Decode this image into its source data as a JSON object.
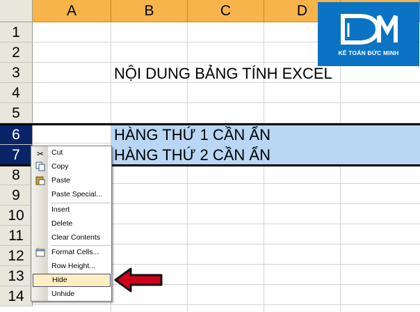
{
  "columns": [
    "A",
    "B",
    "C",
    "D"
  ],
  "rows": [
    "1",
    "2",
    "3",
    "4",
    "5",
    "6",
    "7",
    "8",
    "9",
    "10",
    "11",
    "12",
    "13",
    "14"
  ],
  "selected_rows": [
    "6",
    "7"
  ],
  "cells": {
    "b3": "NỘI DUNG BẢNG TÍNH EXCEL",
    "b6": "HÀNG THỨ 1 CẦN ẨN",
    "b7": "HÀNG THỨ 2 CẦN ẨN"
  },
  "logo": {
    "text": "KẾ TOÁN ĐỨC MINH"
  },
  "context_menu": {
    "items": [
      {
        "label": "Cut",
        "icon": "scissors-icon"
      },
      {
        "label": "Copy",
        "icon": "copy-icon"
      },
      {
        "label": "Paste",
        "icon": "paste-icon"
      },
      {
        "label": "Paste Special...",
        "icon": ""
      },
      {
        "label": "Insert",
        "icon": ""
      },
      {
        "label": "Delete",
        "icon": ""
      },
      {
        "label": "Clear Contents",
        "icon": ""
      },
      {
        "label": "Format Cells...",
        "icon": "format-cells-icon"
      },
      {
        "label": "Row Height...",
        "icon": ""
      },
      {
        "label": "Hide",
        "icon": ""
      },
      {
        "label": "Unhide",
        "icon": ""
      }
    ],
    "highlighted": "Hide"
  },
  "colors": {
    "column_header": "#f7b44a",
    "row_header": "#e9e7dc",
    "selected_header": "#0a246a",
    "selection_fill": "#b9d7f5",
    "logo_bg": "#0a73c4",
    "menu_hover": "#ffeec2",
    "arrow": "#d0021b"
  }
}
